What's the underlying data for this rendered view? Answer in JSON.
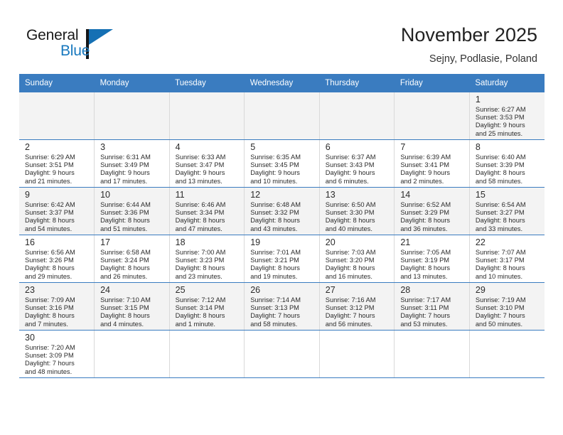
{
  "brand": {
    "name_part1": "General",
    "name_part2": "Blue",
    "flag_icon": "blue-flag-icon"
  },
  "header": {
    "title": "November 2025",
    "subtitle": "Sejny, Podlasie, Poland"
  },
  "calendar": {
    "weekday_headers": [
      "Sunday",
      "Monday",
      "Tuesday",
      "Wednesday",
      "Thursday",
      "Friday",
      "Saturday"
    ],
    "accent_color": "#3a7cc0",
    "shaded_row_color": "#f3f3f3",
    "weeks": [
      [
        {
          "day": "",
          "lines": []
        },
        {
          "day": "",
          "lines": []
        },
        {
          "day": "",
          "lines": []
        },
        {
          "day": "",
          "lines": []
        },
        {
          "day": "",
          "lines": []
        },
        {
          "day": "",
          "lines": []
        },
        {
          "day": "1",
          "lines": [
            "Sunrise: 6:27 AM",
            "Sunset: 3:53 PM",
            "Daylight: 9 hours",
            "and 25 minutes."
          ]
        }
      ],
      [
        {
          "day": "2",
          "lines": [
            "Sunrise: 6:29 AM",
            "Sunset: 3:51 PM",
            "Daylight: 9 hours",
            "and 21 minutes."
          ]
        },
        {
          "day": "3",
          "lines": [
            "Sunrise: 6:31 AM",
            "Sunset: 3:49 PM",
            "Daylight: 9 hours",
            "and 17 minutes."
          ]
        },
        {
          "day": "4",
          "lines": [
            "Sunrise: 6:33 AM",
            "Sunset: 3:47 PM",
            "Daylight: 9 hours",
            "and 13 minutes."
          ]
        },
        {
          "day": "5",
          "lines": [
            "Sunrise: 6:35 AM",
            "Sunset: 3:45 PM",
            "Daylight: 9 hours",
            "and 10 minutes."
          ]
        },
        {
          "day": "6",
          "lines": [
            "Sunrise: 6:37 AM",
            "Sunset: 3:43 PM",
            "Daylight: 9 hours",
            "and 6 minutes."
          ]
        },
        {
          "day": "7",
          "lines": [
            "Sunrise: 6:39 AM",
            "Sunset: 3:41 PM",
            "Daylight: 9 hours",
            "and 2 minutes."
          ]
        },
        {
          "day": "8",
          "lines": [
            "Sunrise: 6:40 AM",
            "Sunset: 3:39 PM",
            "Daylight: 8 hours",
            "and 58 minutes."
          ]
        }
      ],
      [
        {
          "day": "9",
          "lines": [
            "Sunrise: 6:42 AM",
            "Sunset: 3:37 PM",
            "Daylight: 8 hours",
            "and 54 minutes."
          ]
        },
        {
          "day": "10",
          "lines": [
            "Sunrise: 6:44 AM",
            "Sunset: 3:36 PM",
            "Daylight: 8 hours",
            "and 51 minutes."
          ]
        },
        {
          "day": "11",
          "lines": [
            "Sunrise: 6:46 AM",
            "Sunset: 3:34 PM",
            "Daylight: 8 hours",
            "and 47 minutes."
          ]
        },
        {
          "day": "12",
          "lines": [
            "Sunrise: 6:48 AM",
            "Sunset: 3:32 PM",
            "Daylight: 8 hours",
            "and 43 minutes."
          ]
        },
        {
          "day": "13",
          "lines": [
            "Sunrise: 6:50 AM",
            "Sunset: 3:30 PM",
            "Daylight: 8 hours",
            "and 40 minutes."
          ]
        },
        {
          "day": "14",
          "lines": [
            "Sunrise: 6:52 AM",
            "Sunset: 3:29 PM",
            "Daylight: 8 hours",
            "and 36 minutes."
          ]
        },
        {
          "day": "15",
          "lines": [
            "Sunrise: 6:54 AM",
            "Sunset: 3:27 PM",
            "Daylight: 8 hours",
            "and 33 minutes."
          ]
        }
      ],
      [
        {
          "day": "16",
          "lines": [
            "Sunrise: 6:56 AM",
            "Sunset: 3:26 PM",
            "Daylight: 8 hours",
            "and 29 minutes."
          ]
        },
        {
          "day": "17",
          "lines": [
            "Sunrise: 6:58 AM",
            "Sunset: 3:24 PM",
            "Daylight: 8 hours",
            "and 26 minutes."
          ]
        },
        {
          "day": "18",
          "lines": [
            "Sunrise: 7:00 AM",
            "Sunset: 3:23 PM",
            "Daylight: 8 hours",
            "and 23 minutes."
          ]
        },
        {
          "day": "19",
          "lines": [
            "Sunrise: 7:01 AM",
            "Sunset: 3:21 PM",
            "Daylight: 8 hours",
            "and 19 minutes."
          ]
        },
        {
          "day": "20",
          "lines": [
            "Sunrise: 7:03 AM",
            "Sunset: 3:20 PM",
            "Daylight: 8 hours",
            "and 16 minutes."
          ]
        },
        {
          "day": "21",
          "lines": [
            "Sunrise: 7:05 AM",
            "Sunset: 3:19 PM",
            "Daylight: 8 hours",
            "and 13 minutes."
          ]
        },
        {
          "day": "22",
          "lines": [
            "Sunrise: 7:07 AM",
            "Sunset: 3:17 PM",
            "Daylight: 8 hours",
            "and 10 minutes."
          ]
        }
      ],
      [
        {
          "day": "23",
          "lines": [
            "Sunrise: 7:09 AM",
            "Sunset: 3:16 PM",
            "Daylight: 8 hours",
            "and 7 minutes."
          ]
        },
        {
          "day": "24",
          "lines": [
            "Sunrise: 7:10 AM",
            "Sunset: 3:15 PM",
            "Daylight: 8 hours",
            "and 4 minutes."
          ]
        },
        {
          "day": "25",
          "lines": [
            "Sunrise: 7:12 AM",
            "Sunset: 3:14 PM",
            "Daylight: 8 hours",
            "and 1 minute."
          ]
        },
        {
          "day": "26",
          "lines": [
            "Sunrise: 7:14 AM",
            "Sunset: 3:13 PM",
            "Daylight: 7 hours",
            "and 58 minutes."
          ]
        },
        {
          "day": "27",
          "lines": [
            "Sunrise: 7:16 AM",
            "Sunset: 3:12 PM",
            "Daylight: 7 hours",
            "and 56 minutes."
          ]
        },
        {
          "day": "28",
          "lines": [
            "Sunrise: 7:17 AM",
            "Sunset: 3:11 PM",
            "Daylight: 7 hours",
            "and 53 minutes."
          ]
        },
        {
          "day": "29",
          "lines": [
            "Sunrise: 7:19 AM",
            "Sunset: 3:10 PM",
            "Daylight: 7 hours",
            "and 50 minutes."
          ]
        }
      ],
      [
        {
          "day": "30",
          "lines": [
            "Sunrise: 7:20 AM",
            "Sunset: 3:09 PM",
            "Daylight: 7 hours",
            "and 48 minutes."
          ]
        },
        {
          "day": "",
          "lines": []
        },
        {
          "day": "",
          "lines": []
        },
        {
          "day": "",
          "lines": []
        },
        {
          "day": "",
          "lines": []
        },
        {
          "day": "",
          "lines": []
        },
        {
          "day": "",
          "lines": []
        }
      ]
    ]
  }
}
